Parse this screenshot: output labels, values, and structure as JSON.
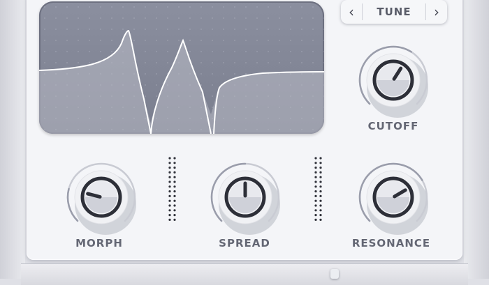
{
  "tuner": {
    "prev_icon": "chevron-left-icon",
    "label": "TUNE",
    "next_icon": "chevron-right-icon"
  },
  "knobs": {
    "cutoff": {
      "label": "CUTOFF",
      "value": 0.62
    },
    "morph": {
      "label": "MORPH",
      "value": 0.22
    },
    "spread": {
      "label": "SPREAD",
      "value": 0.5
    },
    "resonance": {
      "label": "RESONANCE",
      "value": 0.72
    }
  },
  "colors": {
    "panel": "#f4f5f8",
    "display": "#858999",
    "curve": "#ffffff",
    "label": "#646774",
    "knob_ring": "#2d2f38"
  }
}
